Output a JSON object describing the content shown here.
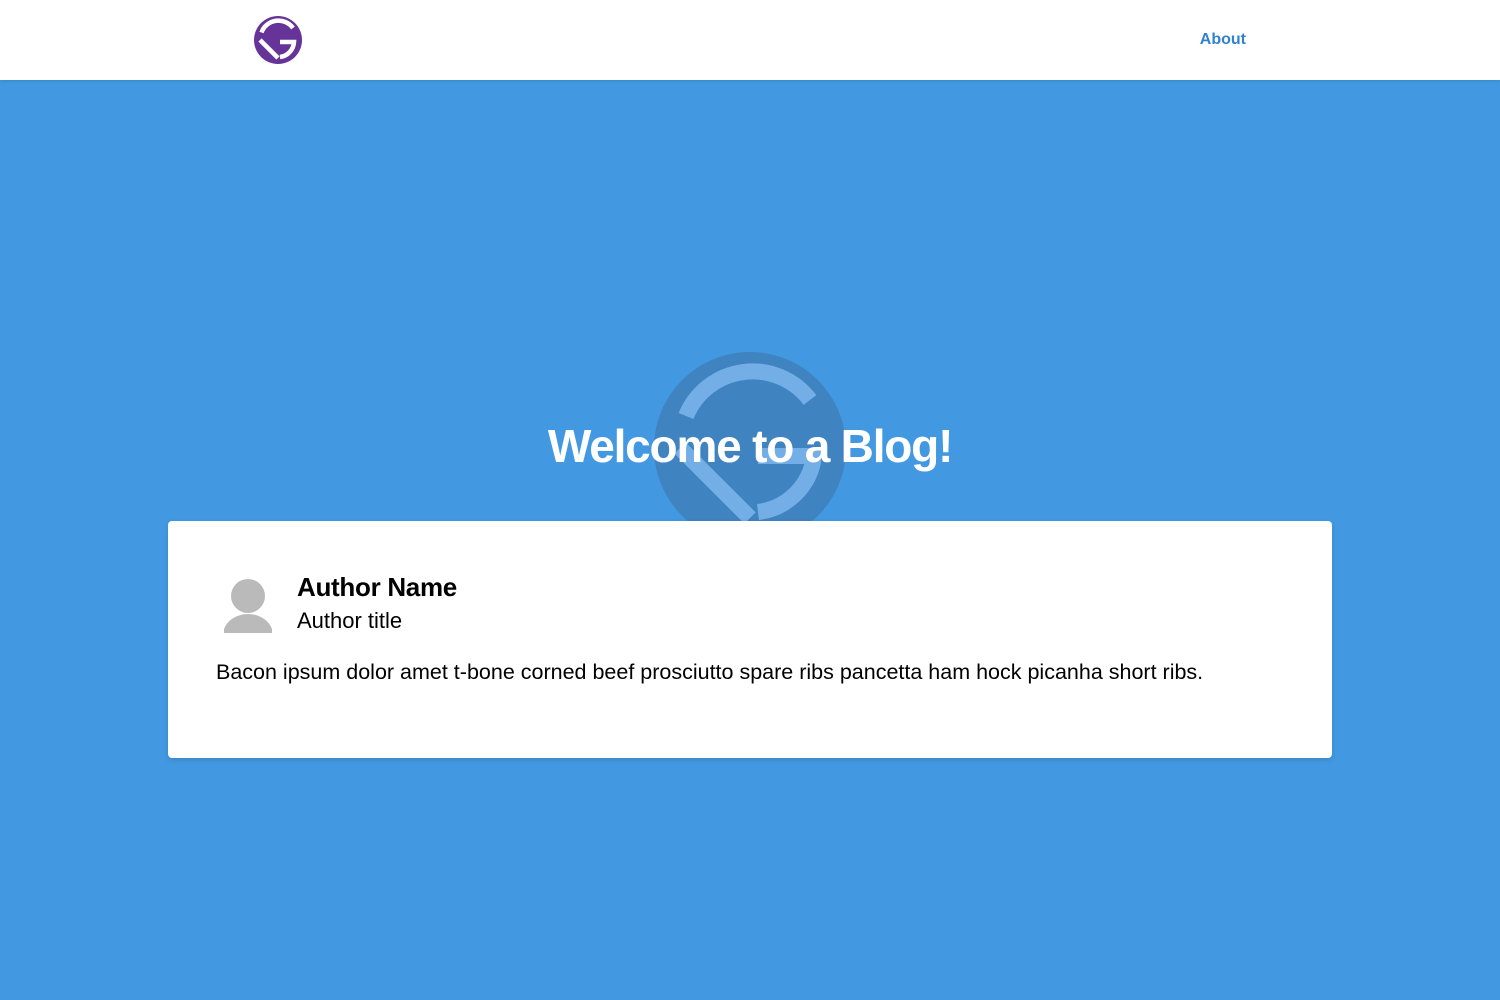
{
  "header": {
    "logo_icon": "gatsby-logo-icon",
    "logo_color": "#663399",
    "nav": [
      {
        "label": "About"
      }
    ],
    "link_color": "#3182ce"
  },
  "hero": {
    "title": "Welcome to a Blog!",
    "background_color": "#4299e1",
    "watermark_icon": "gatsby-logo-icon"
  },
  "card": {
    "author": {
      "avatar_icon": "user-avatar-icon",
      "name": "Author Name",
      "title": "Author title"
    },
    "excerpt": "Bacon ipsum dolor amet t-bone corned beef prosciutto spare ribs pancetta ham hock picanha short ribs."
  }
}
